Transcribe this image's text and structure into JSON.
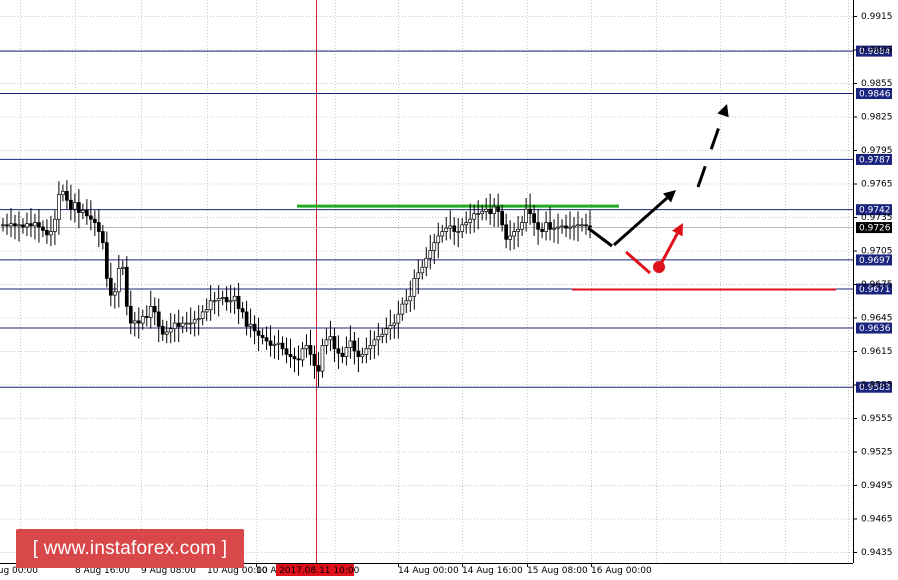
{
  "chart_data": {
    "type": "candlestick",
    "title": "",
    "ylim": [
      0.943,
      0.993
    ],
    "y_ticks": [
      "0.9915",
      "0.9885",
      "0.9855",
      "0.9825",
      "0.9795",
      "0.9765",
      "0.9735",
      "0.9705",
      "0.9675",
      "0.9645",
      "0.9615",
      "0.9585",
      "0.9555",
      "0.9525",
      "0.9495",
      "0.9465",
      "0.9435"
    ],
    "x_ticks": [
      "Aug 00:00",
      "8 Aug 16:00",
      "9 Aug 08:00",
      "10 Aug 00:00",
      "10 Aug",
      "14 Aug 00:00",
      "14 Aug 16:00",
      "15 Aug 08:00",
      "16 Aug 00:00"
    ],
    "current_time_label": "2017.08.11 10:00",
    "current_price": "0.9726",
    "levels": [
      {
        "label": "0.9884",
        "value": 0.9884
      },
      {
        "label": "0.9846",
        "value": 0.9846
      },
      {
        "label": "0.9787",
        "value": 0.9787
      },
      {
        "label": "0.9742",
        "value": 0.9742
      },
      {
        "label": "0.9697",
        "value": 0.9697
      },
      {
        "label": "0.9671",
        "value": 0.9671
      },
      {
        "label": "0.9636",
        "value": 0.9636
      },
      {
        "label": "0.9583",
        "value": 0.9583
      }
    ],
    "resistance_zone": 0.9742,
    "support_zone": 0.9671,
    "price_path": [
      0.9728,
      0.9727,
      0.9729,
      0.9727,
      0.9728,
      0.9726,
      0.9729,
      0.9727,
      0.973,
      0.9726,
      0.9723,
      0.9719,
      0.9722,
      0.9733,
      0.9755,
      0.9758,
      0.975,
      0.9742,
      0.9748,
      0.9739,
      0.9741,
      0.9736,
      0.9733,
      0.973,
      0.9722,
      0.9712,
      0.968,
      0.9665,
      0.9668,
      0.9689,
      0.969,
      0.9655,
      0.964,
      0.9642,
      0.964,
      0.9646,
      0.9645,
      0.9655,
      0.965,
      0.9637,
      0.963,
      0.9632,
      0.9635,
      0.964,
      0.9637,
      0.964,
      0.964,
      0.964,
      0.9643,
      0.9644,
      0.965,
      0.9652,
      0.966,
      0.966,
      0.9662,
      0.9663,
      0.9659,
      0.966,
      0.9664,
      0.9653,
      0.965,
      0.9637,
      0.9639,
      0.9633,
      0.9629,
      0.9627,
      0.9624,
      0.962,
      0.9621,
      0.9622,
      0.9617,
      0.9612,
      0.961,
      0.9608,
      0.9607,
      0.9617,
      0.962,
      0.9612,
      0.9602,
      0.9597,
      0.962,
      0.9625,
      0.9628,
      0.9617,
      0.9613,
      0.961,
      0.9618,
      0.9624,
      0.9615,
      0.961,
      0.9612,
      0.9617,
      0.962,
      0.9625,
      0.9628,
      0.963,
      0.9635,
      0.9638,
      0.964,
      0.9648,
      0.9657,
      0.966,
      0.9664,
      0.968,
      0.9685,
      0.969,
      0.9698,
      0.9705,
      0.9712,
      0.9718,
      0.9722,
      0.9725,
      0.9727,
      0.9722,
      0.9722,
      0.9728,
      0.973,
      0.9733,
      0.9738,
      0.9738,
      0.974,
      0.9742,
      0.9738,
      0.9744,
      0.974,
      0.9728,
      0.9715,
      0.9718,
      0.9722,
      0.9724,
      0.973,
      0.9742,
      0.9738,
      0.973,
      0.9724,
      0.9722,
      0.973,
      0.9724,
      0.9725,
      0.9726,
      0.9727,
      0.9725,
      0.9726,
      0.9727,
      0.9728,
      0.9728,
      0.9727,
      0.9726
    ],
    "annotations": [
      {
        "type": "arrow",
        "color": "#000000",
        "style": "solid",
        "from": [
          "16 Aug 08:00",
          0.9705
        ],
        "to": [
          "16 Aug 16:00",
          0.978
        ]
      },
      {
        "type": "arrow",
        "color": "#000000",
        "style": "dashed",
        "from": [
          "16 Aug 16:00",
          0.978
        ],
        "to": [
          "17 Aug 04:00",
          0.984
        ]
      },
      {
        "type": "arrow",
        "color": "#e0101a",
        "style": "dashed",
        "from": [
          "16 Aug 08:00",
          0.9705
        ],
        "to": [
          "16 Aug 14:00",
          0.9728
        ]
      }
    ],
    "grid": true
  },
  "watermark": "[ www.instaforex.com ]",
  "colors": {
    "level_line": "#1a237e",
    "support": "#e0101a",
    "resistance": "#22aa22",
    "time_line": "#cc2222",
    "bull": "#ffffff",
    "bear": "#000000"
  }
}
